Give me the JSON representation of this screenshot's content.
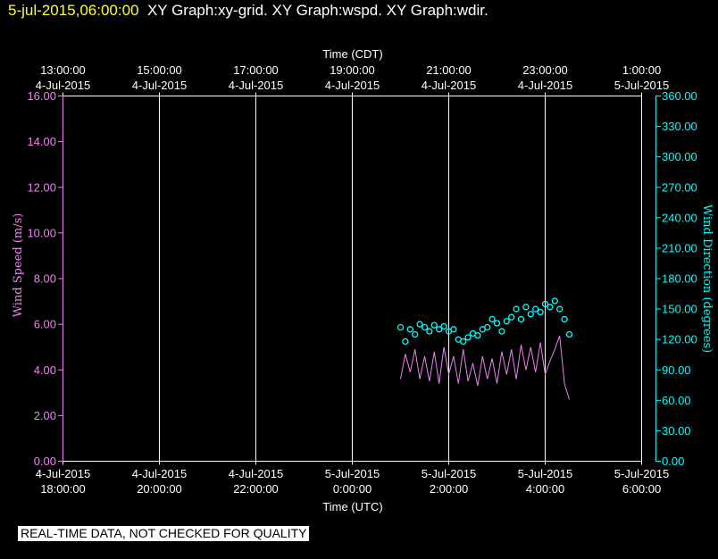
{
  "header": {
    "timestamp": "5-jul-2015,06:00:00",
    "graphs": "XY Graph:xy-grid.  XY Graph:wspd.  XY Graph:wdir."
  },
  "notice": "REAL-TIME DATA, NOT CHECKED FOR QUALITY",
  "colors": {
    "background": "#000000",
    "grid": "#ffffff",
    "wind_speed": "#ee82ee",
    "wind_direction": "#00ffff",
    "header_timestamp": "#ffff33"
  },
  "chart_data": {
    "type": "line",
    "grid": true,
    "x_range_utc_hours": [
      18,
      30
    ],
    "top_axis": {
      "title": "Time (CDT)",
      "ticks": [
        {
          "time": "13:00:00",
          "date": "4-Jul-2015"
        },
        {
          "time": "15:00:00",
          "date": "4-Jul-2015"
        },
        {
          "time": "17:00:00",
          "date": "4-Jul-2015"
        },
        {
          "time": "19:00:00",
          "date": "4-Jul-2015"
        },
        {
          "time": "21:00:00",
          "date": "4-Jul-2015"
        },
        {
          "time": "23:00:00",
          "date": "4-Jul-2015"
        },
        {
          "time": "1:00:00",
          "date": "5-Jul-2015"
        }
      ]
    },
    "bottom_axis": {
      "title": "Time (UTC)",
      "ticks": [
        {
          "date": "4-Jul-2015",
          "time": "18:00:00"
        },
        {
          "date": "4-Jul-2015",
          "time": "20:00:00"
        },
        {
          "date": "4-Jul-2015",
          "time": "22:00:00"
        },
        {
          "date": "5-Jul-2015",
          "time": "0:00:00"
        },
        {
          "date": "5-Jul-2015",
          "time": "2:00:00"
        },
        {
          "date": "5-Jul-2015",
          "time": "4:00:00"
        },
        {
          "date": "5-Jul-2015",
          "time": "6:00:00"
        }
      ]
    },
    "left_axis": {
      "title": "Wind Speed (m/s)",
      "ylim": [
        0,
        16
      ],
      "ticks": [
        "0.00",
        "2.00",
        "4.00",
        "6.00",
        "8.00",
        "10.00",
        "12.00",
        "14.00",
        "16.00"
      ]
    },
    "right_axis": {
      "title": "Wind Direction (degrees)",
      "ylim": [
        0,
        360
      ],
      "ticks": [
        "0.00",
        "30.00",
        "60.00",
        "90.00",
        "120.00",
        "150.00",
        "180.00",
        "210.00",
        "240.00",
        "270.00",
        "300.00",
        "330.00",
        "360.00"
      ]
    },
    "series": [
      {
        "name": "Wind Speed",
        "axis": "left",
        "style": "line",
        "x": [
          1.0,
          1.1,
          1.2,
          1.3,
          1.4,
          1.5,
          1.6,
          1.7,
          1.8,
          1.9,
          2.0,
          2.1,
          2.2,
          2.3,
          2.4,
          2.5,
          2.6,
          2.7,
          2.8,
          2.9,
          3.0,
          3.1,
          3.2,
          3.3,
          3.4,
          3.5,
          3.6,
          3.7,
          3.8,
          3.9,
          4.0,
          4.1,
          4.2,
          4.3,
          4.4,
          4.5
        ],
        "values": [
          3.6,
          4.7,
          3.9,
          4.9,
          3.6,
          4.6,
          3.5,
          4.8,
          3.4,
          5.0,
          3.8,
          4.6,
          3.4,
          4.9,
          3.5,
          4.3,
          3.3,
          4.6,
          3.6,
          4.5,
          3.4,
          4.8,
          3.8,
          4.9,
          3.6,
          5.1,
          4.0,
          5.0,
          3.9,
          5.2,
          3.8,
          4.4,
          4.9,
          5.5,
          3.4,
          2.7
        ]
      },
      {
        "name": "Wind Direction",
        "axis": "right",
        "style": "markers",
        "x": [
          1.0,
          1.1,
          1.2,
          1.3,
          1.4,
          1.5,
          1.6,
          1.7,
          1.8,
          1.9,
          2.0,
          2.1,
          2.2,
          2.3,
          2.4,
          2.5,
          2.6,
          2.7,
          2.8,
          2.9,
          3.0,
          3.1,
          3.2,
          3.3,
          3.4,
          3.5,
          3.6,
          3.7,
          3.8,
          3.9,
          4.0,
          4.1,
          4.2,
          4.3,
          4.4,
          4.5
        ],
        "values": [
          132,
          118,
          130,
          125,
          135,
          132,
          128,
          134,
          130,
          133,
          128,
          130,
          120,
          118,
          122,
          126,
          124,
          130,
          132,
          140,
          136,
          128,
          138,
          142,
          150,
          140,
          152,
          145,
          150,
          147,
          155,
          152,
          158,
          150,
          140,
          125
        ]
      }
    ]
  }
}
